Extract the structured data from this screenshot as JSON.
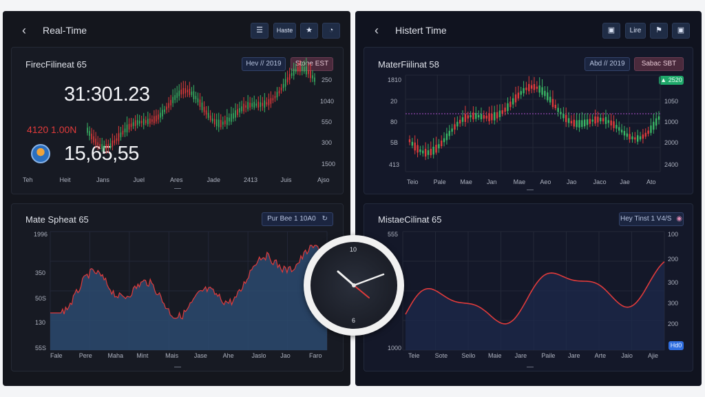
{
  "left": {
    "title": "Real-Time",
    "back_icon": "chevron-left-icon",
    "toolbar": {
      "menu_icon": "menu-icon",
      "btn_label": "Haste",
      "star_icon": "star-icon",
      "pie_icon": "pie-icon"
    },
    "card1": {
      "title": "FirecFilineat 65",
      "pill1": "Hev // 2019",
      "pill2": "Stone EST",
      "big_value": "31:301.23",
      "red_value": "4120 1.00N",
      "big_value2": "15,65,55",
      "y_labels": [
        "250",
        "1040",
        "550",
        "300",
        "1500"
      ],
      "x_labels": [
        "Teh",
        "Heit",
        "Jans",
        "Juel",
        "Ares",
        "Jade",
        "2413",
        "Juis",
        "Ajso"
      ]
    },
    "card2": {
      "title": "Mate Spheat 65",
      "pill": "Pur Bee  1 10A0",
      "pill_icon": "refresh-icon",
      "y_labels": [
        "1996",
        "350",
        "50S",
        "130",
        "55S"
      ],
      "x_labels": [
        "Fale",
        "Pere",
        "Maha",
        "Mint",
        "Mais",
        "Jase",
        "Ahe",
        "Jaslo",
        "Jao",
        "Faro"
      ]
    }
  },
  "right": {
    "title": "Histert Time",
    "back_icon": "chevron-left-icon",
    "toolbar": {
      "grid_icon": "grid-icon",
      "btn_label": "Lire",
      "shield_icon": "shield-icon",
      "box_icon": "box-icon"
    },
    "card1": {
      "title": "MaterFiilinat 58",
      "pill1": "Abd // 2019",
      "pill2": "Sabac SBT",
      "badge": "▲ 2520",
      "y_labels_left": [
        "1810",
        "20",
        "80",
        "5B",
        "413"
      ],
      "y_labels_right": [
        "1050",
        "1000",
        "2000",
        "2400"
      ],
      "x_labels": [
        "Teio",
        "Pale",
        "Mae",
        "Jan",
        "Mae",
        "Aeo",
        "Jao",
        "Jaco",
        "Jae",
        "Ato"
      ]
    },
    "card2": {
      "title": "MistaeCilinat 65",
      "pill": "Hey Tinst 1 V4/S",
      "pill_icon": "pin-icon",
      "btn": "Hd0",
      "y_labels_left": [
        "555",
        "1000"
      ],
      "y_labels_right": [
        "100",
        "200",
        "300",
        "300",
        "200"
      ],
      "x_labels": [
        "Teie",
        "Sote",
        "Seilo",
        "Maie",
        "Jare",
        "Paile",
        "Jare",
        "Arte",
        "Jaio",
        "Ajie"
      ]
    }
  },
  "clock": {
    "n12": "10",
    "n6": "6"
  },
  "colors": {
    "up": "#3ab765",
    "down": "#e23b3b",
    "area": "#2b4a6e"
  }
}
